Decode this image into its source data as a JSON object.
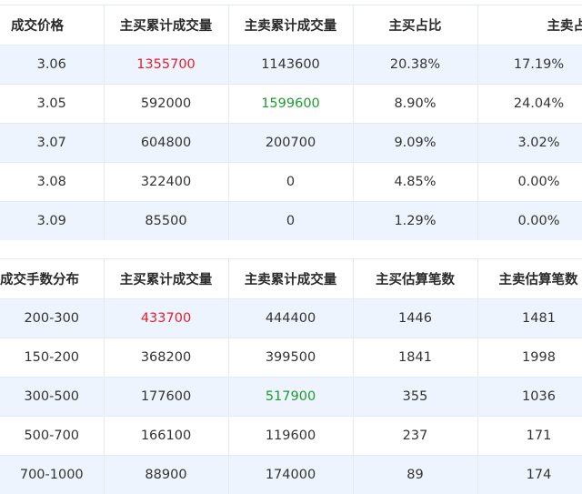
{
  "price_table": {
    "headers": [
      "成交价格",
      "主买累计成交量",
      "主卖累计成交量",
      "主买占比",
      "主卖占比"
    ],
    "rows": [
      {
        "price": "3.06",
        "buy_volume": "1355700",
        "sell_volume": "1143600",
        "buy_ratio": "20.38%",
        "sell_ratio": "17.19%",
        "buy_color": "red",
        "sell_color": ""
      },
      {
        "price": "3.05",
        "buy_volume": "592000",
        "sell_volume": "1599600",
        "buy_ratio": "8.90%",
        "sell_ratio": "24.04%",
        "buy_color": "",
        "sell_color": "green"
      },
      {
        "price": "3.07",
        "buy_volume": "604800",
        "sell_volume": "200700",
        "buy_ratio": "9.09%",
        "sell_ratio": "3.02%",
        "buy_color": "",
        "sell_color": ""
      },
      {
        "price": "3.08",
        "buy_volume": "322400",
        "sell_volume": "0",
        "buy_ratio": "4.85%",
        "sell_ratio": "0.00%",
        "buy_color": "",
        "sell_color": ""
      },
      {
        "price": "3.09",
        "buy_volume": "85500",
        "sell_volume": "0",
        "buy_ratio": "1.29%",
        "sell_ratio": "0.00%",
        "buy_color": "",
        "sell_color": ""
      }
    ]
  },
  "lot_table": {
    "headers": [
      "成交手数分布",
      "主买累计成交量",
      "主卖累计成交量",
      "主买估算笔数",
      "主卖估算笔数"
    ],
    "rows": [
      {
        "range": "200-300",
        "buy_volume": "433700",
        "sell_volume": "444400",
        "buy_count": "1446",
        "sell_count": "1481",
        "buy_color": "red",
        "sell_color": ""
      },
      {
        "range": "150-200",
        "buy_volume": "368200",
        "sell_volume": "399500",
        "buy_count": "1841",
        "sell_count": "1998",
        "buy_color": "",
        "sell_color": ""
      },
      {
        "range": "300-500",
        "buy_volume": "177600",
        "sell_volume": "517900",
        "buy_count": "355",
        "sell_count": "1036",
        "buy_color": "",
        "sell_color": "green"
      },
      {
        "range": "500-700",
        "buy_volume": "166100",
        "sell_volume": "119600",
        "buy_count": "237",
        "sell_count": "171",
        "buy_color": "",
        "sell_color": ""
      },
      {
        "range": "700-1000",
        "buy_volume": "88900",
        "sell_volume": "174000",
        "buy_count": "89",
        "sell_count": "174",
        "buy_color": "",
        "sell_color": ""
      }
    ]
  },
  "colors": {
    "shaded_row": "#eef4fd",
    "border": "#e3eaf3",
    "highlight_red": "#e0202e",
    "highlight_green": "#1f9a2e"
  }
}
